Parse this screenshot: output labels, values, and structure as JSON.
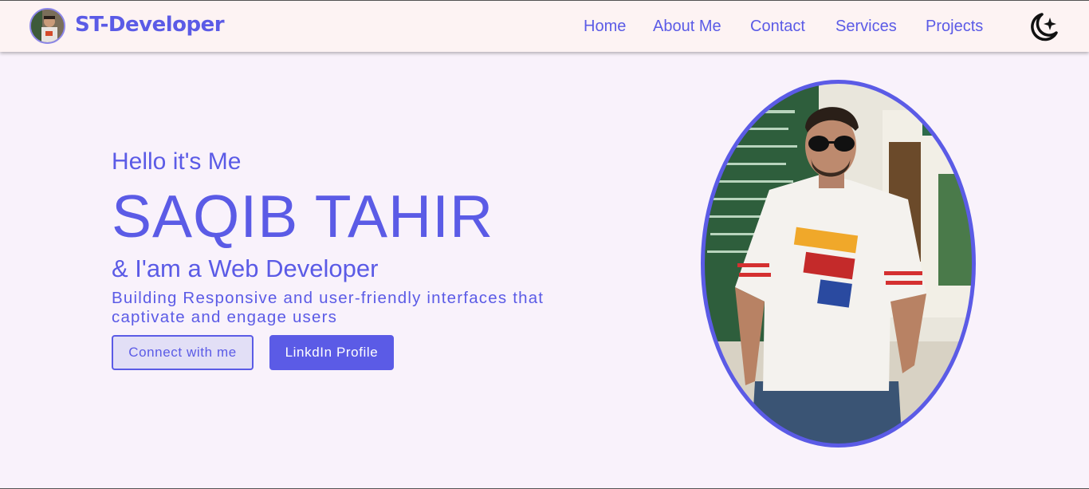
{
  "navbar": {
    "brand": "ST-Developer",
    "links": [
      "Home",
      "About Me",
      "Contact",
      "Services",
      "Projects"
    ],
    "theme_icon": "moon-star-icon"
  },
  "hero": {
    "greeting": "Hello it's Me",
    "name": "SAQIB TAHIR",
    "role": "& I'am a Web Developer",
    "tagline": "Building Responsive and user-friendly interfaces that captivate and engage users",
    "buttons": {
      "connect": "Connect with me",
      "linkedin": "LinkdIn Profile"
    }
  },
  "colors": {
    "accent": "#5b5be6",
    "page_background": "#f9f2fb",
    "navbar_background": "#fdf3f3"
  }
}
